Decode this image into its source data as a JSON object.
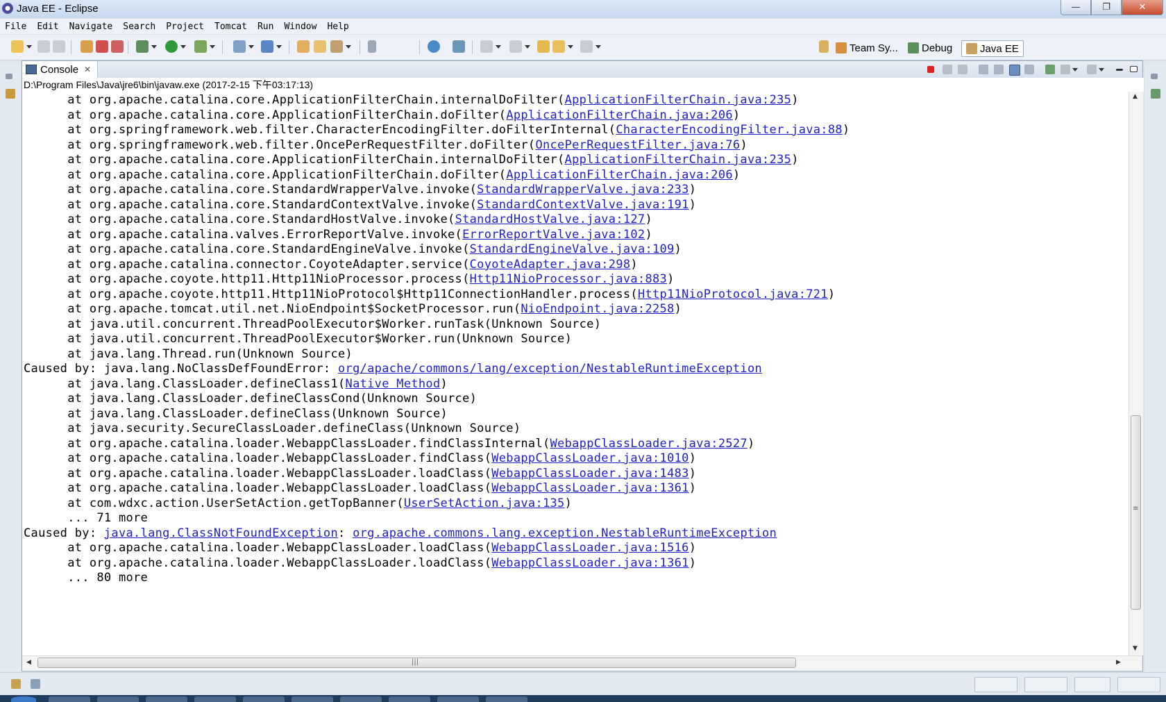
{
  "window": {
    "title": "Java EE - Eclipse",
    "controls": {
      "minimize": "—",
      "restore": "❐",
      "close": "✕"
    }
  },
  "menubar": [
    "File",
    "Edit",
    "Navigate",
    "Search",
    "Project",
    "Tomcat",
    "Run",
    "Window",
    "Help"
  ],
  "perspectives": [
    {
      "label": "Team Sy...",
      "icon": "team-sync-icon",
      "active": false
    },
    {
      "label": "Debug",
      "icon": "debug-icon",
      "active": false
    },
    {
      "label": "Java EE",
      "icon": "java-ee-icon",
      "active": true
    }
  ],
  "console": {
    "tab_label": "Console",
    "tab_close": "✕",
    "process_path": "D:\\Program Files\\Java\\jre6\\bin\\javaw.exe (2017-2-15 下午03:17:13)",
    "lines": [
      {
        "text": "      at org.apache.catalina.core.ApplicationFilterChain.internalDoFilter(",
        "link": "ApplicationFilterChain.java:235",
        "suffix": ")"
      },
      {
        "text": "      at org.apache.catalina.core.ApplicationFilterChain.doFilter(",
        "link": "ApplicationFilterChain.java:206",
        "suffix": ")"
      },
      {
        "text": "      at org.springframework.web.filter.CharacterEncodingFilter.doFilterInternal(",
        "link": "CharacterEncodingFilter.java:88",
        "suffix": ")"
      },
      {
        "text": "      at org.springframework.web.filter.OncePerRequestFilter.doFilter(",
        "link": "OncePerRequestFilter.java:76",
        "suffix": ")"
      },
      {
        "text": "      at org.apache.catalina.core.ApplicationFilterChain.internalDoFilter(",
        "link": "ApplicationFilterChain.java:235",
        "suffix": ")"
      },
      {
        "text": "      at org.apache.catalina.core.ApplicationFilterChain.doFilter(",
        "link": "ApplicationFilterChain.java:206",
        "suffix": ")"
      },
      {
        "text": "      at org.apache.catalina.core.StandardWrapperValve.invoke(",
        "link": "StandardWrapperValve.java:233",
        "suffix": ")"
      },
      {
        "text": "      at org.apache.catalina.core.StandardContextValve.invoke(",
        "link": "StandardContextValve.java:191",
        "suffix": ")"
      },
      {
        "text": "      at org.apache.catalina.core.StandardHostValve.invoke(",
        "link": "StandardHostValve.java:127",
        "suffix": ")"
      },
      {
        "text": "      at org.apache.catalina.valves.ErrorReportValve.invoke(",
        "link": "ErrorReportValve.java:102",
        "suffix": ")"
      },
      {
        "text": "      at org.apache.catalina.core.StandardEngineValve.invoke(",
        "link": "StandardEngineValve.java:109",
        "suffix": ")"
      },
      {
        "text": "      at org.apache.catalina.connector.CoyoteAdapter.service(",
        "link": "CoyoteAdapter.java:298",
        "suffix": ")"
      },
      {
        "text": "      at org.apache.coyote.http11.Http11NioProcessor.process(",
        "link": "Http11NioProcessor.java:883",
        "suffix": ")"
      },
      {
        "text": "      at org.apache.coyote.http11.Http11NioProtocol$Http11ConnectionHandler.process(",
        "link": "Http11NioProtocol.java:721",
        "suffix": ")"
      },
      {
        "text": "      at org.apache.tomcat.util.net.NioEndpoint$SocketProcessor.run(",
        "link": "NioEndpoint.java:2258",
        "suffix": ")"
      },
      {
        "text": "      at java.util.concurrent.ThreadPoolExecutor$Worker.runTask(Unknown Source)",
        "link": "",
        "suffix": ""
      },
      {
        "text": "      at java.util.concurrent.ThreadPoolExecutor$Worker.run(Unknown Source)",
        "link": "",
        "suffix": ""
      },
      {
        "text": "      at java.lang.Thread.run(Unknown Source)",
        "link": "",
        "suffix": ""
      },
      {
        "text": "Caused by: java.lang.NoClassDefFoundError: ",
        "link": "org/apache/commons/lang/exception/NestableRuntimeException",
        "suffix": ""
      },
      {
        "text": "      at java.lang.ClassLoader.defineClass1(",
        "link": "Native Method",
        "suffix": ")"
      },
      {
        "text": "      at java.lang.ClassLoader.defineClassCond(Unknown Source)",
        "link": "",
        "suffix": ""
      },
      {
        "text": "      at java.lang.ClassLoader.defineClass(Unknown Source)",
        "link": "",
        "suffix": ""
      },
      {
        "text": "      at java.security.SecureClassLoader.defineClass(Unknown Source)",
        "link": "",
        "suffix": ""
      },
      {
        "text": "      at org.apache.catalina.loader.WebappClassLoader.findClassInternal(",
        "link": "WebappClassLoader.java:2527",
        "suffix": ")"
      },
      {
        "text": "      at org.apache.catalina.loader.WebappClassLoader.findClass(",
        "link": "WebappClassLoader.java:1010",
        "suffix": ")"
      },
      {
        "text": "      at org.apache.catalina.loader.WebappClassLoader.loadClass(",
        "link": "WebappClassLoader.java:1483",
        "suffix": ")"
      },
      {
        "text": "      at org.apache.catalina.loader.WebappClassLoader.loadClass(",
        "link": "WebappClassLoader.java:1361",
        "suffix": ")"
      },
      {
        "text": "      at com.wdxc.action.UserSetAction.getTopBanner(",
        "link": "UserSetAction.java:135",
        "suffix": ")"
      },
      {
        "text": "      ... 71 more",
        "link": "",
        "suffix": ""
      },
      {
        "text": "Caused by: ",
        "link": "java.lang.ClassNotFoundException",
        "suffix": ": ",
        "link2": "org.apache.commons.lang.exception.NestableRuntimeException"
      },
      {
        "text": "      at org.apache.catalina.loader.WebappClassLoader.loadClass(",
        "link": "WebappClassLoader.java:1516",
        "suffix": ")"
      },
      {
        "text": "      at org.apache.catalina.loader.WebappClassLoader.loadClass(",
        "link": "WebappClassLoader.java:1361",
        "suffix": ")"
      },
      {
        "text": "      ... 80 more",
        "link": "",
        "suffix": ""
      }
    ]
  },
  "colors": {
    "link": "#1f1fc7",
    "terminate": "#e02020",
    "titlebar": "#c6d9ef"
  }
}
